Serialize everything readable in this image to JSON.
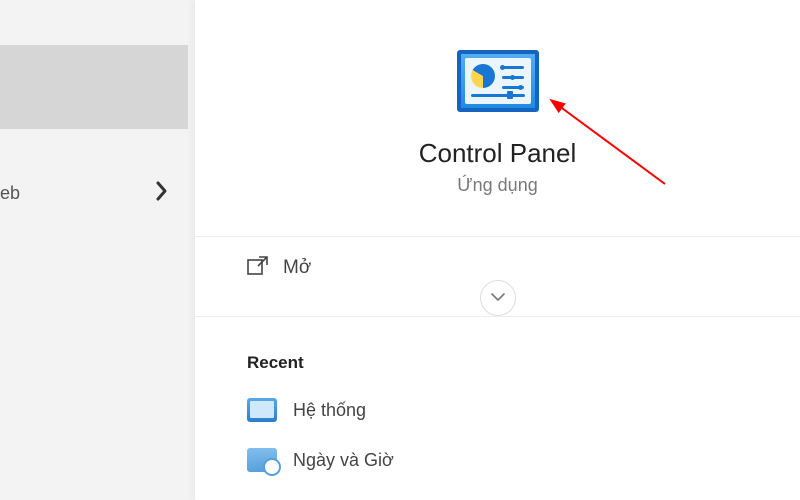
{
  "sidebar": {
    "partial_label": "eb"
  },
  "hero": {
    "app_title": "Control Panel",
    "app_subtitle": "Ứng dụng"
  },
  "actions": {
    "open_label": "Mở"
  },
  "recent": {
    "heading": "Recent",
    "items": [
      {
        "label": "Hệ thống"
      },
      {
        "label": "Ngày và Giờ"
      }
    ]
  }
}
